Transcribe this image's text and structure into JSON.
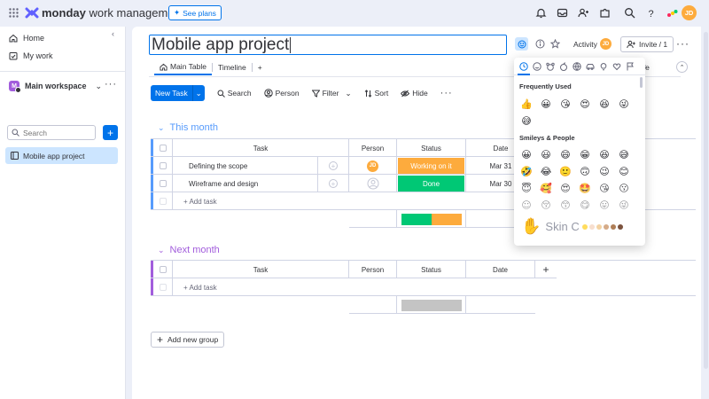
{
  "topbar": {
    "brand_bold": "monday",
    "brand_rest": " work management",
    "see_plans": "See plans",
    "user_initials": "JD"
  },
  "sidebar": {
    "home": "Home",
    "my_work": "My work",
    "workspace": "Main workspace",
    "workspace_initial": "M",
    "search_placeholder": "Search",
    "board": "Mobile app project"
  },
  "board": {
    "title": "Mobile app project",
    "activity": "Activity",
    "invite": "Invite / 1",
    "tabs": [
      {
        "label": "Main Table"
      },
      {
        "label": "Timeline"
      }
    ],
    "add_tab": "+",
    "partial_tab": "ate",
    "toolbar": {
      "new_task": "New Task",
      "search": "Search",
      "person": "Person",
      "filter": "Filter",
      "sort": "Sort",
      "hide": "Hide"
    }
  },
  "groups": [
    {
      "title": "This month",
      "color": "#579bfc",
      "columns": {
        "task": "Task",
        "person": "Person",
        "status": "Status",
        "date": "Date"
      },
      "rows": [
        {
          "task": "Defining the scope",
          "person": "JD",
          "status": "Working on it",
          "status_color": "#fdab3d",
          "date": "Mar 31"
        },
        {
          "task": "Wireframe and design",
          "person": "",
          "status": "Done",
          "status_color": "#00c875",
          "date": "Mar 30"
        }
      ],
      "add_task": "+ Add task",
      "summary": [
        {
          "color": "#00c875",
          "share": 0.5
        },
        {
          "color": "#fdab3d",
          "share": 0.5
        }
      ]
    },
    {
      "title": "Next month",
      "color": "#a25ddc",
      "columns": {
        "task": "Task",
        "person": "Person",
        "status": "Status",
        "date": "Date"
      },
      "rows": [],
      "add_task": "+ Add task",
      "summary": [
        {
          "color": "#c4c4c4",
          "share": 1
        }
      ]
    }
  ],
  "add_group": "Add new group",
  "emoji_picker": {
    "frequently_used": "Frequently Used",
    "frequent": [
      "👍",
      "😀",
      "😘",
      "😍",
      "😆",
      "😜",
      "😅"
    ],
    "smileys_label": "Smileys & People",
    "smileys": [
      "😀",
      "😃",
      "😄",
      "😁",
      "😆",
      "😅",
      "🤣",
      "😂",
      "🙂",
      "🙃",
      "😉",
      "😊",
      "😇",
      "🥰",
      "😍",
      "🤩",
      "😘",
      "😗",
      "☺",
      "😚",
      "😙",
      "😋",
      "😛",
      "😜"
    ],
    "skin_label": "Skin C",
    "skin_hand": "✋",
    "tones": [
      "#ffdc5d",
      "#f7dece",
      "#f3d2a2",
      "#d5ab88",
      "#af7e57",
      "#7c533e"
    ]
  }
}
